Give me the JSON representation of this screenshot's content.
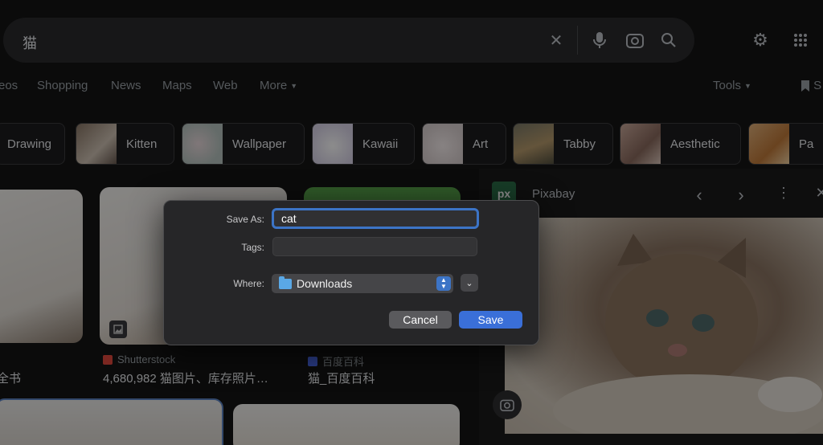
{
  "search": {
    "query": "猫"
  },
  "header_icons": [
    "settings-icon",
    "apps-grid-icon"
  ],
  "tabs": [
    {
      "label": "eos"
    },
    {
      "label": "Shopping"
    },
    {
      "label": "News"
    },
    {
      "label": "Maps"
    },
    {
      "label": "Web"
    },
    {
      "label": "More"
    }
  ],
  "tools": {
    "label": "Tools"
  },
  "saved_label": "S",
  "chips": [
    {
      "label": "Drawing"
    },
    {
      "label": "Kitten"
    },
    {
      "label": "Wallpaper"
    },
    {
      "label": "Kawaii"
    },
    {
      "label": "Art"
    },
    {
      "label": "Tabby"
    },
    {
      "label": "Aesthetic"
    },
    {
      "label": "Pa"
    }
  ],
  "results": [
    {
      "source": "",
      "title": "全书"
    },
    {
      "source": "Shutterstock",
      "title": "4,680,982 猫图片、库存照片…"
    },
    {
      "source": "百度百科",
      "title": "猫_百度百科"
    }
  ],
  "preview": {
    "source": "Pixabay",
    "logo_text": "px"
  },
  "dialog": {
    "save_as_label": "Save As:",
    "save_as_value": "cat",
    "tags_label": "Tags:",
    "where_label": "Where:",
    "where_value": "Downloads",
    "cancel_label": "Cancel",
    "save_label": "Save"
  },
  "colors": {
    "accent": "#3a6fd8",
    "focus_ring": "#3c74c6",
    "pixabay": "#2a6d48",
    "shutterstock": "#e0483c",
    "baidu": "#4e6ef2"
  }
}
